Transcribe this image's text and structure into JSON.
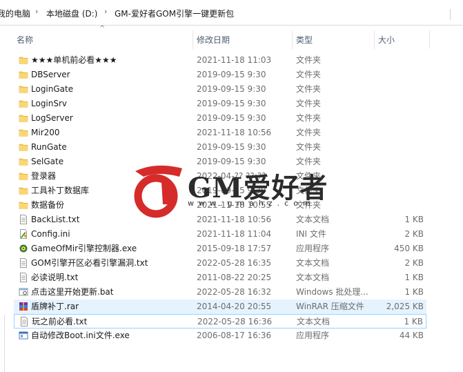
{
  "breadcrumb": [
    "我的电脑",
    "本地磁盘 (D:)",
    "GM-爱好者GOM引擎一键更新包"
  ],
  "columns": {
    "name": "名称",
    "date": "修改日期",
    "type": "类型",
    "size": "大小"
  },
  "files": [
    {
      "name": "★★★单机前必看★★★",
      "date": "2021-11-18 11:03",
      "type": "文件夹",
      "size": "",
      "icon": "folder-icon"
    },
    {
      "name": "DBServer",
      "date": "2019-09-15 9:30",
      "type": "文件夹",
      "size": "",
      "icon": "folder-icon"
    },
    {
      "name": "LoginGate",
      "date": "2019-09-15 9:30",
      "type": "文件夹",
      "size": "",
      "icon": "folder-icon"
    },
    {
      "name": "LoginSrv",
      "date": "2019-09-15 9:30",
      "type": "文件夹",
      "size": "",
      "icon": "folder-icon"
    },
    {
      "name": "LogServer",
      "date": "2019-09-15 9:30",
      "type": "文件夹",
      "size": "",
      "icon": "folder-icon"
    },
    {
      "name": "Mir200",
      "date": "2021-11-18 10:56",
      "type": "文件夹",
      "size": "",
      "icon": "folder-icon"
    },
    {
      "name": "RunGate",
      "date": "2019-09-15 9:30",
      "type": "文件夹",
      "size": "",
      "icon": "folder-icon"
    },
    {
      "name": "SelGate",
      "date": "2019-09-15 9:30",
      "type": "文件夹",
      "size": "",
      "icon": "folder-icon"
    },
    {
      "name": "登录器",
      "date": "2022-04-?? ??:??",
      "type": "文件夹",
      "size": "",
      "icon": "folder-icon"
    },
    {
      "name": "工具补丁数据库",
      "date": "2019-09-15 9:30",
      "type": "文件夹",
      "size": "",
      "icon": "folder-icon"
    },
    {
      "name": "数据备份",
      "date": "2021-11-18 10:55",
      "type": "文件夹",
      "size": "",
      "icon": "folder-icon"
    },
    {
      "name": "BackList.txt",
      "date": "2021-11-18 10:56",
      "type": "文本文档",
      "size": "1 KB",
      "icon": "text-file-icon"
    },
    {
      "name": "Config.ini",
      "date": "2021-11-18 11:04",
      "type": "INI 文件",
      "size": "2 KB",
      "icon": "ini-file-icon"
    },
    {
      "name": "GameOfMir引擎控制器.exe",
      "date": "2015-09-18 17:57",
      "type": "应用程序",
      "size": "450 KB",
      "icon": "exe-gear-icon"
    },
    {
      "name": "GOM引擎开区必看引擎漏洞.txt",
      "date": "2022-05-28 16:35",
      "type": "文本文档",
      "size": "2 KB",
      "icon": "text-file-icon"
    },
    {
      "name": "必读说明.txt",
      "date": "2011-08-22 20:25",
      "type": "文本文档",
      "size": "1 KB",
      "icon": "text-file-icon"
    },
    {
      "name": "点击这里开始更新.bat",
      "date": "2022-05-28 16:32",
      "type": "Windows 批处理...",
      "size": "1 KB",
      "icon": "bat-file-icon"
    },
    {
      "name": "盾牌补丁.rar",
      "date": "2014-04-20 20:55",
      "type": "WinRAR 压缩文件",
      "size": "2,025 KB",
      "icon": "rar-file-icon"
    },
    {
      "name": "玩之前必看.txt",
      "date": "2022-05-28 16:36",
      "type": "文本文档",
      "size": "1 KB",
      "icon": "text-file-icon"
    },
    {
      "name": "自动修改Boot.ini文件.exe",
      "date": "2006-08-17 16:36",
      "type": "应用程序",
      "size": "44 KB",
      "icon": "exe-window-icon"
    }
  ],
  "watermark": {
    "title": "GM爱好者",
    "url": "www.gmahz.com"
  },
  "colors": {
    "folder": "#f7c95c",
    "selected_bg": "#e5f3ff",
    "selected_border": "#99d1ff",
    "watermark_red": "#d62b2b",
    "header_text": "#4c5c6e"
  }
}
